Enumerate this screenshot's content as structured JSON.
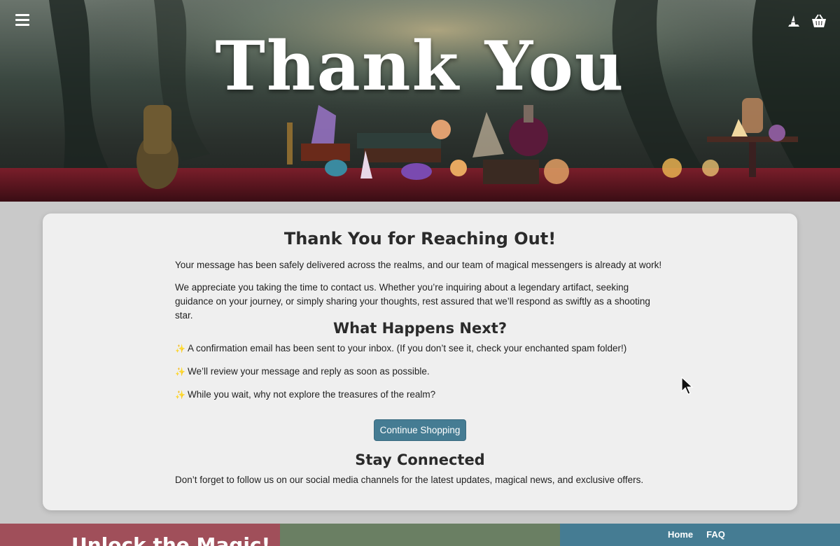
{
  "hero": {
    "title": "Thank You"
  },
  "card": {
    "heading": "Thank You for Reaching Out!",
    "para1": "Your message has been safely delivered across the realms, and our team of magical messengers is already at work!",
    "para2": "We appreciate you taking the time to contact us. Whether you’re inquiring about a legendary artifact, seeking guidance on your journey, or simply sharing your thoughts, rest assured that we’ll respond as swiftly as a shooting star.",
    "next_heading": "What Happens Next?",
    "bullets": [
      "A confirmation email has been sent to your inbox. (If you don’t see it, check your enchanted spam folder!)",
      "We’ll review your message and reply as soon as possible.",
      "While you wait, why not explore the treasures of the realm?"
    ],
    "button_label": "Continue Shopping",
    "stay_heading": "Stay Connected",
    "stay_text": "Don’t forget to follow us on our social media channels for the latest updates, magical news, and exclusive offers."
  },
  "footer": {
    "promo": "Unlock the Magic!",
    "nav": [
      "Home",
      "FAQ"
    ]
  },
  "icons": {
    "menu": "hamburger-menu-icon",
    "hat": "wizard-hat-icon",
    "basket": "basket-icon",
    "bullet": "magic-wand-icon"
  },
  "colors": {
    "button": "#457c93",
    "footer_left": "#a04f5a",
    "footer_mid": "#6a7f63",
    "footer_right": "#457c93"
  }
}
